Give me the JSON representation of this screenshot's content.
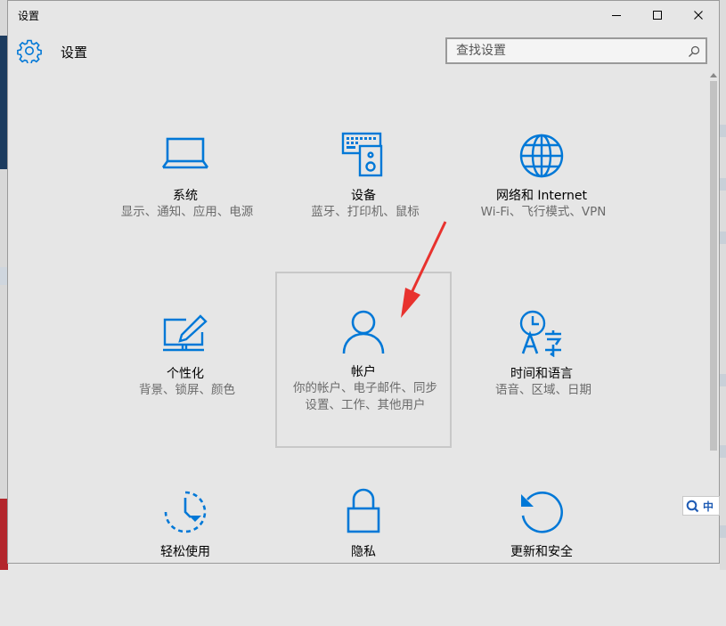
{
  "window": {
    "title": "设置",
    "controls": {
      "minimize": "minimize-icon",
      "maximize": "maximize-icon",
      "close": "close-icon"
    }
  },
  "header": {
    "icon": "gear-icon",
    "title": "设置"
  },
  "search": {
    "placeholder": "查找设置",
    "value": "",
    "icon": "search-icon"
  },
  "accent_color": "#0078d7",
  "tiles": [
    {
      "icon": "laptop-icon",
      "name": "系统",
      "desc": "显示、通知、应用、电源"
    },
    {
      "icon": "devices-icon",
      "name": "设备",
      "desc": "蓝牙、打印机、鼠标"
    },
    {
      "icon": "globe-icon",
      "name": "网络和 Internet",
      "desc": "Wi-Fi、飞行模式、VPN"
    },
    {
      "icon": "personalization-icon",
      "name": "个性化",
      "desc": "背景、锁屏、颜色"
    },
    {
      "icon": "account-icon",
      "name": "帐户",
      "desc": "你的帐户、电子邮件、同步设置、工作、其他用户"
    },
    {
      "icon": "time-language-icon",
      "name": "时间和语言",
      "desc": "语音、区域、日期"
    },
    {
      "icon": "ease-of-access-icon",
      "name": "轻松使用",
      "desc": ""
    },
    {
      "icon": "lock-icon",
      "name": "隐私",
      "desc": ""
    },
    {
      "icon": "update-icon",
      "name": "更新和安全",
      "desc": ""
    }
  ],
  "ime": {
    "icon": "search-icon",
    "label": "中"
  }
}
